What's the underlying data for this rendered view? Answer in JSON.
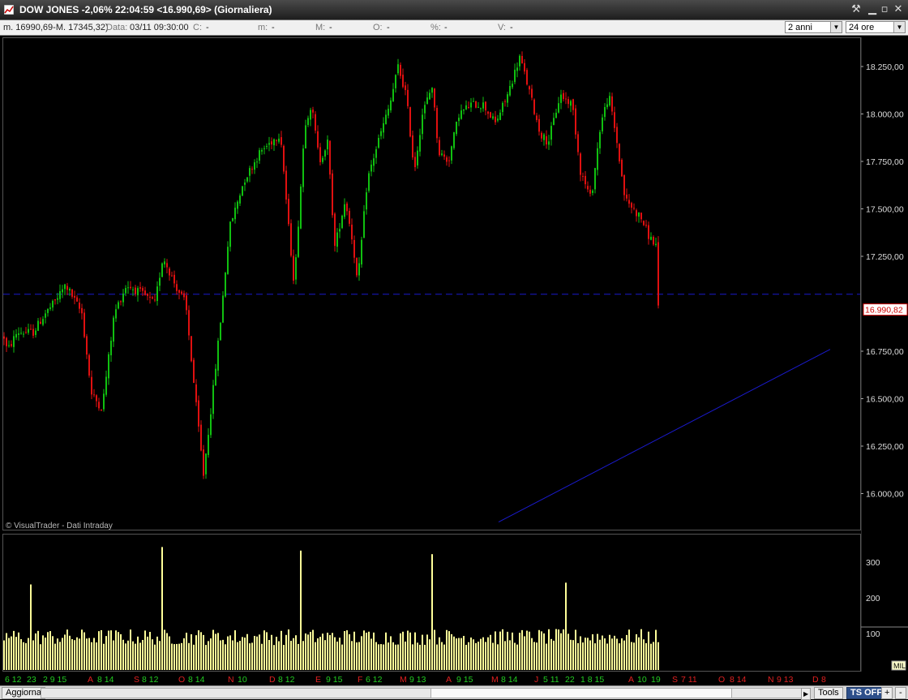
{
  "window": {
    "title": "DOW JONES -2,06% 22:04:59  <16.990,69> (Giornaliera)"
  },
  "infobar": {
    "range": "m. 16990,69-M. 17345,32)",
    "data_label": "Data:",
    "data_value": "03/11 09:30:00",
    "c_label": "C:",
    "c_value": "-",
    "m_label": "m:",
    "m_value": "-",
    "M_label": "M:",
    "M_value": "-",
    "o_label": "O:",
    "o_value": "-",
    "pct_label": "%:",
    "pct_value": "-",
    "v_label": "V:",
    "v_value": "-",
    "period_select": "2 anni",
    "hours_select": "24 ore"
  },
  "price_axis": {
    "labels": [
      "18.250,00",
      "18.000,00",
      "17.750,00",
      "17.500,00",
      "17.250,00",
      "16.750,00",
      "16.500,00",
      "16.250,00",
      "16.000,00"
    ],
    "current_price_label": "16.990,82"
  },
  "volume_axis": {
    "labels": [
      "300",
      "200",
      "100"
    ],
    "unit": "MIL"
  },
  "watermark": "© VisualTrader - Dati Intraday",
  "date_axis": [
    {
      "t": "6 12",
      "c": "g"
    },
    {
      "t": "23",
      "c": "g"
    },
    {
      "t": "2 9 15",
      "c": "g"
    },
    {
      "t": "A",
      "c": "r"
    },
    {
      "t": "8 14",
      "c": "g"
    },
    {
      "t": "S",
      "c": "r"
    },
    {
      "t": "8 12",
      "c": "g"
    },
    {
      "t": "O",
      "c": "r"
    },
    {
      "t": "8 14",
      "c": "g"
    },
    {
      "t": "N",
      "c": "r"
    },
    {
      "t": "10",
      "c": "g"
    },
    {
      "t": "D",
      "c": "r"
    },
    {
      "t": "8 12",
      "c": "g"
    },
    {
      "t": "E",
      "c": "r"
    },
    {
      "t": "9 15",
      "c": "g"
    },
    {
      "t": "F",
      "c": "r"
    },
    {
      "t": "6 12",
      "c": "g"
    },
    {
      "t": "M",
      "c": "r"
    },
    {
      "t": "9 13",
      "c": "g"
    },
    {
      "t": "A",
      "c": "r"
    },
    {
      "t": "9 15",
      "c": "g"
    },
    {
      "t": "M",
      "c": "r"
    },
    {
      "t": "8 14",
      "c": "g"
    },
    {
      "t": "J",
      "c": "r"
    },
    {
      "t": "5 11",
      "c": "g"
    },
    {
      "t": "22",
      "c": "g"
    },
    {
      "t": "1 8 15",
      "c": "g"
    },
    {
      "t": "A",
      "c": "r"
    },
    {
      "t": "10",
      "c": "g"
    },
    {
      "t": "19",
      "c": "g"
    },
    {
      "t": "S",
      "c": "r"
    },
    {
      "t": "7 11",
      "c": "r"
    },
    {
      "t": "O",
      "c": "r"
    },
    {
      "t": "8 14",
      "c": "r"
    },
    {
      "t": "N",
      "c": "r"
    },
    {
      "t": "9 13",
      "c": "r"
    },
    {
      "t": "D",
      "c": "r"
    },
    {
      "t": "8",
      "c": "r"
    }
  ],
  "bottombar": {
    "refresh_button": "Aggiorna",
    "tools_button": "Tools",
    "ts_button": "TS OFF",
    "plus_button": "+",
    "minus_button": "-"
  },
  "colors": {
    "up": "#10c010",
    "down": "#e01010",
    "volume": "#ffff99",
    "trendline": "#1a1acc"
  },
  "chart_data": {
    "type": "candlestick",
    "title": "DOW JONES",
    "timeframe": "Giornaliera",
    "ylim": [
      15850,
      18400
    ],
    "last_price": 16990.82,
    "reference_line": 17050,
    "trendline": [
      [
        1024,
        16760
      ],
      [
        615,
        15850
      ]
    ],
    "waypoints": [
      [
        0,
        16900
      ],
      [
        8,
        16750
      ],
      [
        20,
        16850
      ],
      [
        40,
        16850
      ],
      [
        55,
        16950
      ],
      [
        65,
        17000
      ],
      [
        80,
        17100
      ],
      [
        100,
        16950
      ],
      [
        112,
        16520
      ],
      [
        125,
        16450
      ],
      [
        140,
        16950
      ],
      [
        155,
        17100
      ],
      [
        175,
        17050
      ],
      [
        190,
        17000
      ],
      [
        200,
        17250
      ],
      [
        215,
        17100
      ],
      [
        228,
        17000
      ],
      [
        240,
        16500
      ],
      [
        250,
        16100
      ],
      [
        262,
        16550
      ],
      [
        272,
        16950
      ],
      [
        282,
        17400
      ],
      [
        300,
        17650
      ],
      [
        320,
        17800
      ],
      [
        345,
        17900
      ],
      [
        355,
        17400
      ],
      [
        362,
        17100
      ],
      [
        375,
        17950
      ],
      [
        383,
        18050
      ],
      [
        393,
        17750
      ],
      [
        403,
        17850
      ],
      [
        412,
        17300
      ],
      [
        425,
        17550
      ],
      [
        435,
        17300
      ],
      [
        440,
        17100
      ],
      [
        452,
        17650
      ],
      [
        465,
        17850
      ],
      [
        480,
        18050
      ],
      [
        490,
        18250
      ],
      [
        500,
        18100
      ],
      [
        510,
        17700
      ],
      [
        520,
        18000
      ],
      [
        532,
        18150
      ],
      [
        540,
        17800
      ],
      [
        552,
        17750
      ],
      [
        565,
        18000
      ],
      [
        580,
        18050
      ],
      [
        595,
        18050
      ],
      [
        610,
        17950
      ],
      [
        625,
        18100
      ],
      [
        640,
        18300
      ],
      [
        650,
        18150
      ],
      [
        665,
        17900
      ],
      [
        675,
        17850
      ],
      [
        690,
        18100
      ],
      [
        705,
        18050
      ],
      [
        715,
        17700
      ],
      [
        728,
        17550
      ],
      [
        740,
        17950
      ],
      [
        750,
        18100
      ],
      [
        760,
        17850
      ],
      [
        770,
        17550
      ],
      [
        780,
        17500
      ],
      [
        790,
        17450
      ],
      [
        800,
        17350
      ],
      [
        810,
        17300
      ],
      [
        812,
        16990
      ]
    ],
    "volume_ylim": [
      0,
      360
    ],
    "volume_bars": 272,
    "volume_spikes": [
      [
        36,
        240
      ],
      [
        200,
        345
      ],
      [
        370,
        335
      ],
      [
        531,
        325
      ],
      [
        697,
        245
      ]
    ]
  }
}
